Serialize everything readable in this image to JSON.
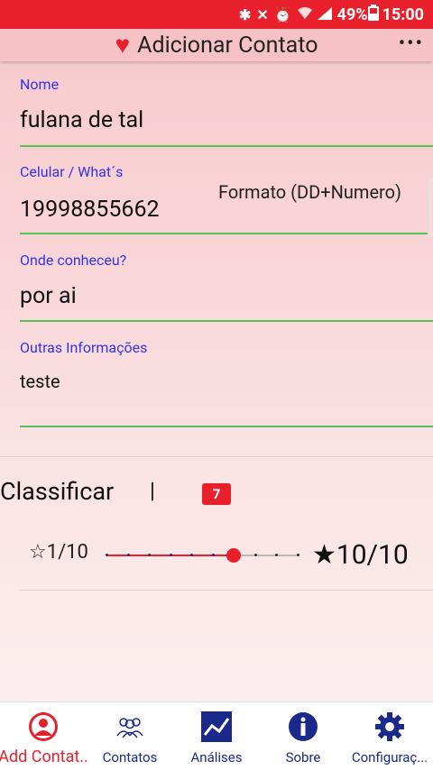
{
  "status_bar": {
    "battery_percent": "49%",
    "time": "15:00",
    "icons": [
      "bluetooth-icon",
      "mute-icon",
      "alarm-icon",
      "wifi-icon",
      "signal-icon",
      "battery-icon"
    ]
  },
  "app_bar": {
    "title": "Adicionar Contato",
    "heart": "♥",
    "more": "•••"
  },
  "form": {
    "nome": {
      "label": "Nome",
      "value": "fulana de tal"
    },
    "celular": {
      "label": "Celular / What´s",
      "value": "19998855662",
      "hint": "Formato (DD+Numero)"
    },
    "onde": {
      "label": "Onde conheceu?",
      "value": "por ai"
    },
    "outras": {
      "label": "Outras Informações",
      "value": "teste"
    }
  },
  "classificar": {
    "title": "Classificar",
    "separator": "|",
    "badge": "7",
    "min_label": "☆1/10",
    "max_label": "★10/10",
    "slider": {
      "min": 1,
      "max": 10,
      "value": 7
    }
  },
  "bottom_nav": {
    "items": [
      {
        "label": "Add Contat..",
        "icon": "add-contact-icon",
        "active": true
      },
      {
        "label": "Contatos",
        "icon": "contacts-icon",
        "active": false
      },
      {
        "label": "Análises",
        "icon": "chart-icon",
        "active": false
      },
      {
        "label": "Sobre",
        "icon": "info-icon",
        "active": false
      },
      {
        "label": "Configuraç...",
        "icon": "gear-icon",
        "active": false
      }
    ]
  },
  "colors": {
    "accent": "#e8202b",
    "nav_blue": "#1b2a8a",
    "label_blue": "#3333e6",
    "underline_green": "#55c35a"
  }
}
